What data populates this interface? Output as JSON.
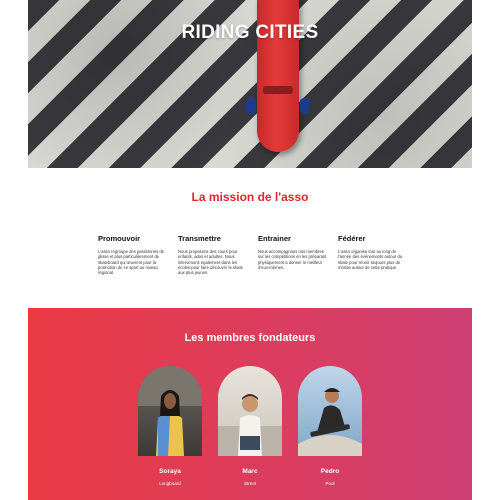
{
  "hero": {
    "title": "RIDING CITIES"
  },
  "mission": {
    "title": "La mission de l'asso",
    "columns": [
      {
        "heading": "Promouvoir",
        "text": "L'asso regroupe des passionnés de glisse et plus particulièrement de skateboard qui œuvrent pour la promotion de ce sport au niveau régional."
      },
      {
        "heading": "Transmettre",
        "text": "Nous proposons des cours pour enfants, ados et adultes. Nous intervenons également dans les écoles pour faire découvrir le skate aux plus jeunes."
      },
      {
        "heading": "Entrainer",
        "text": "Nous accompagnons nos membres sur les compétitions en les préparant physiquement à donner le meilleur d'eux-mêmes."
      },
      {
        "heading": "Fédérer",
        "text": "L'asso organise tout au long de l'année des évènements autour du skate pour réunir toujours plus de monde autour de cette pratique."
      }
    ]
  },
  "founders": {
    "title": "Les membres fondateurs",
    "members": [
      {
        "name": "Soraya",
        "role": "Longboard"
      },
      {
        "name": "Marc",
        "role": "Street"
      },
      {
        "name": "Pedro",
        "role": "Pool"
      }
    ]
  },
  "colors": {
    "accent": "#e0262f",
    "gradient_start": "#ea3a43",
    "gradient_end": "#cf3f74"
  }
}
